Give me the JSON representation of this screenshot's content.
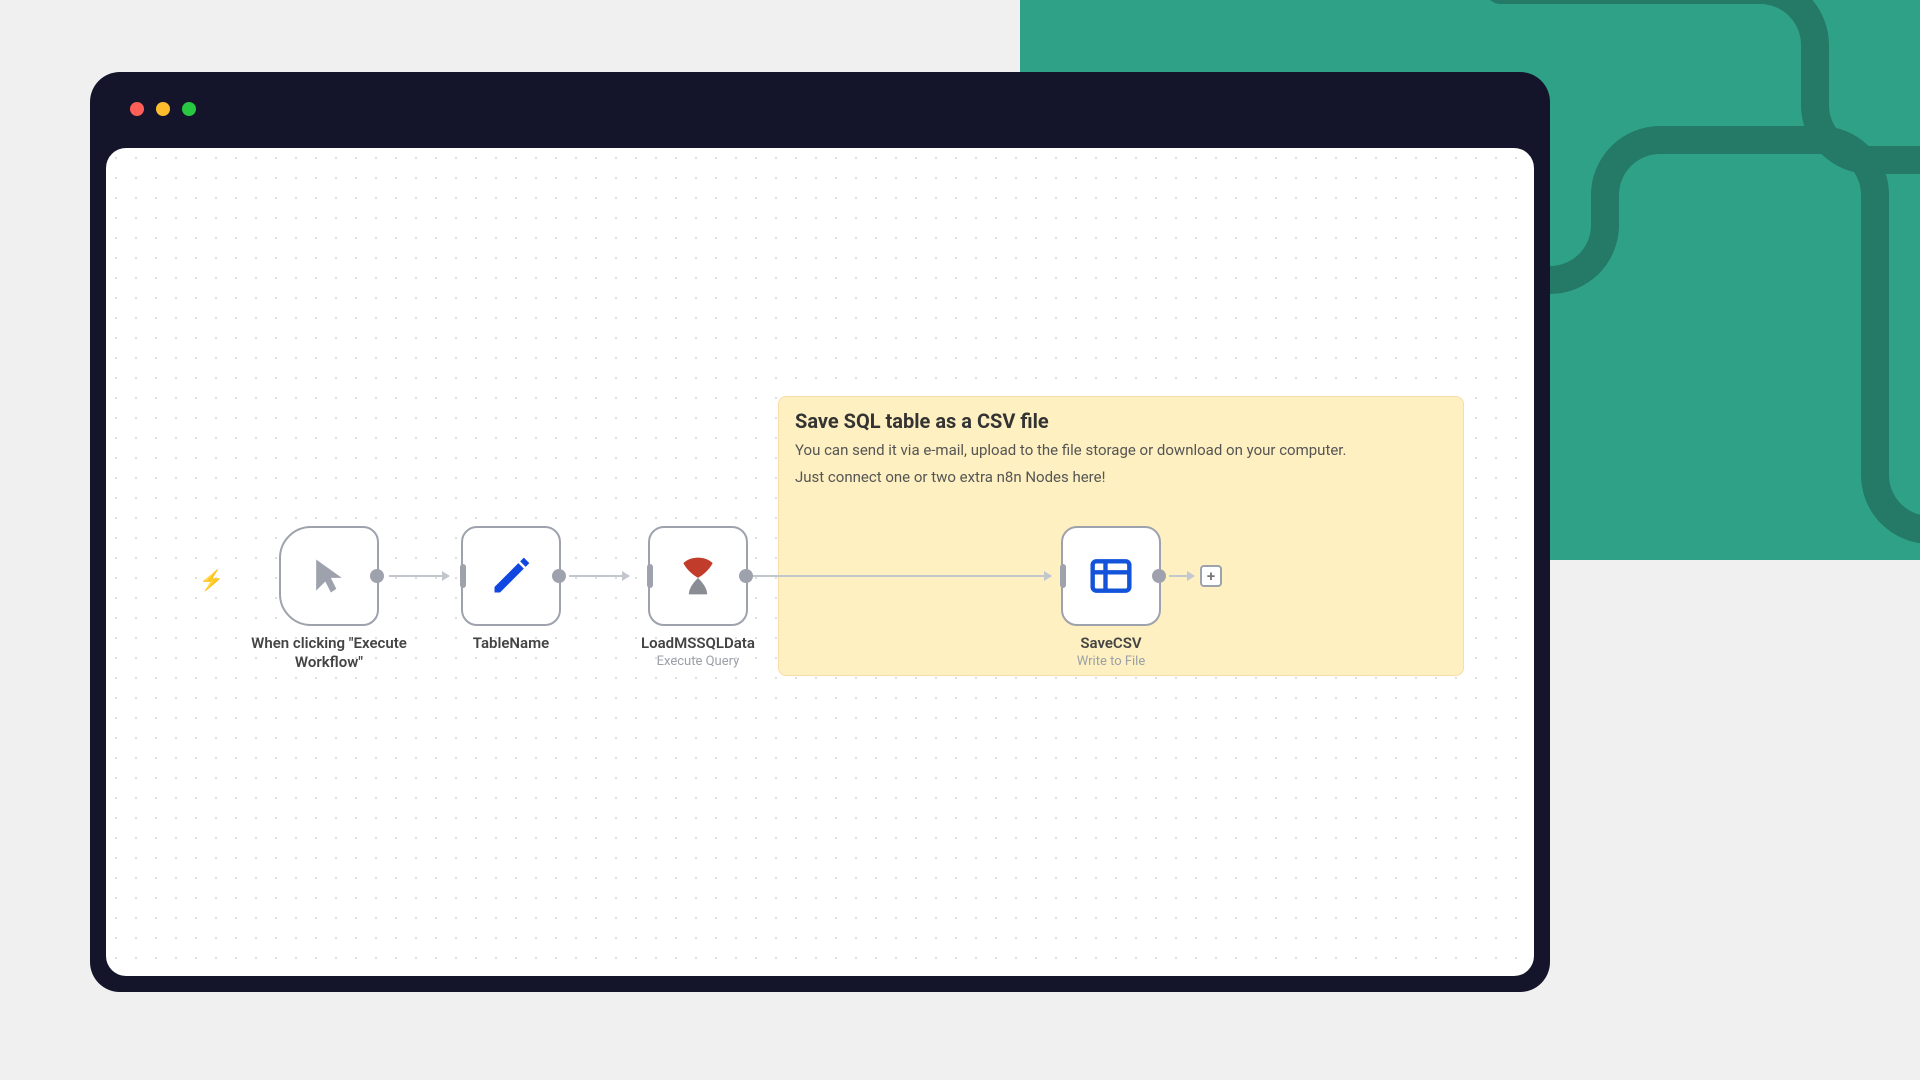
{
  "sticky": {
    "title": "Save SQL table as a CSV file",
    "line1": "You can send it via e-mail, upload to the file storage or download on your computer.",
    "line2": "Just connect one or two extra n8n Nodes here!"
  },
  "nodes": {
    "trigger": {
      "title": "When clicking \"Execute Workflow\"",
      "icon": "cursor-icon",
      "sub": ""
    },
    "set": {
      "title": "TableName",
      "icon": "pencil-icon",
      "sub": ""
    },
    "mssql": {
      "title": "LoadMSSQLData",
      "icon": "mssql-icon",
      "sub": "Execute Query"
    },
    "csv": {
      "title": "SaveCSV",
      "icon": "spreadsheet-icon",
      "sub": "Write to File"
    }
  },
  "add_button": "+",
  "colors": {
    "teal": "#2fa187",
    "dark": "#14142b"
  }
}
